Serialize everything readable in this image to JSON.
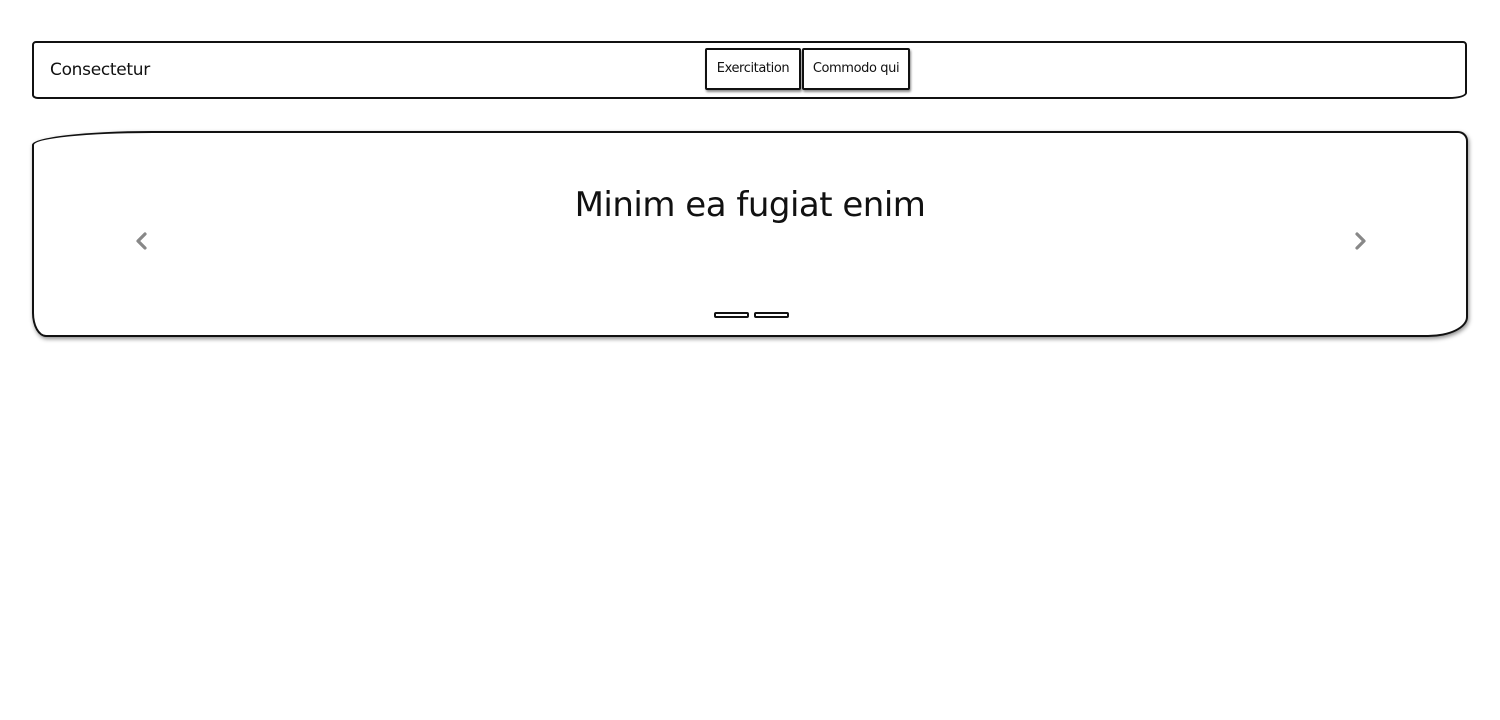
{
  "navbar": {
    "brand": "Consectetur",
    "buttons": [
      {
        "label": "Exercitation"
      },
      {
        "label": "Commodo qui"
      }
    ]
  },
  "carousel": {
    "slide_title": "Minim ea fugiat enim",
    "prev_icon": "chevron-left-icon",
    "next_icon": "chevron-right-icon",
    "indicator_count": 2,
    "arrow_color": "#888888"
  }
}
